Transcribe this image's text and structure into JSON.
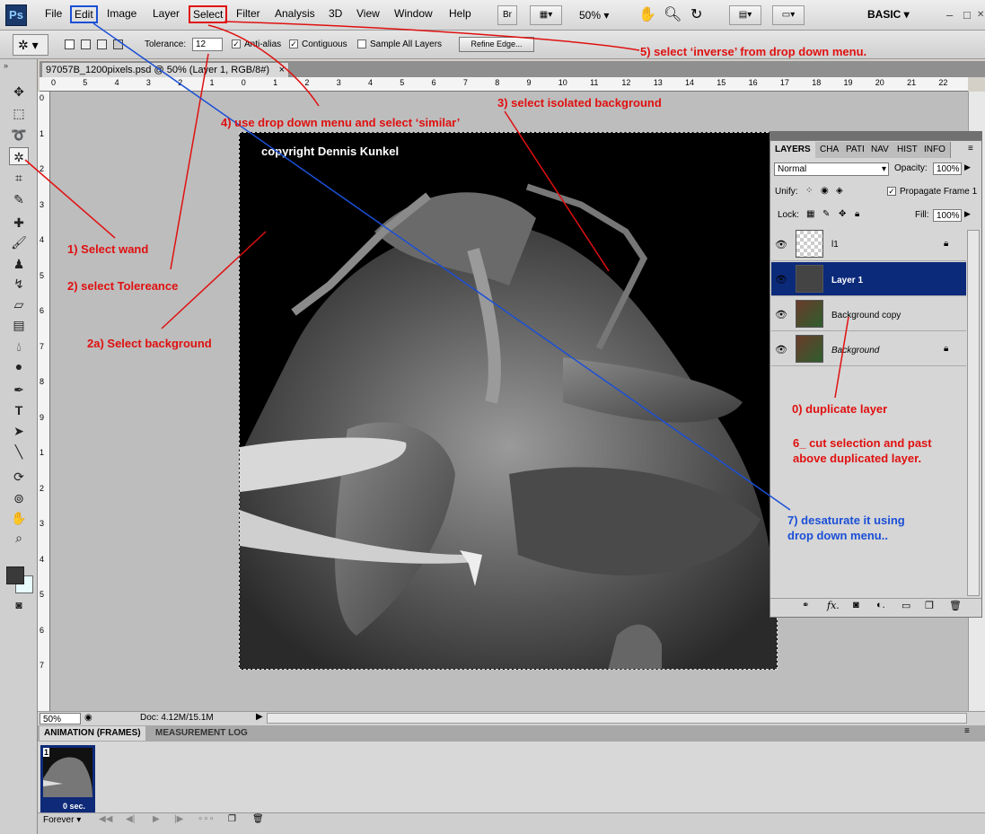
{
  "app": {
    "logo_text": "Ps",
    "workspace_label": "BASIC"
  },
  "menu": [
    "File",
    "Edit",
    "Image",
    "Layer",
    "Select",
    "Filter",
    "Analysis",
    "3D",
    "View",
    "Window",
    "Help"
  ],
  "toolbar": {
    "bridge_label": "Br",
    "zoom": "50%"
  },
  "window_controls": {
    "minimize": "–",
    "restore": "□",
    "close": "✕"
  },
  "options": {
    "tolerance_label": "Tolerance:",
    "tolerance_value": "12",
    "anti_alias": "Anti-alias",
    "contiguous": "Contiguous",
    "sample_all": "Sample All Layers",
    "refine_edge": "Refine Edge..."
  },
  "document": {
    "tab_title": "97057B_1200pixels.psd @ 50% (Layer 1, RGB/8#)",
    "close": "×",
    "watermark": "copyright Dennis Kunkel"
  },
  "ruler": {
    "h": [
      "0",
      "5",
      "4",
      "3",
      "2",
      "1",
      "0",
      "1",
      "2",
      "3",
      "4",
      "5",
      "6",
      "7",
      "8",
      "9",
      "10",
      "11",
      "12",
      "13",
      "14",
      "15",
      "16",
      "17",
      "18",
      "19",
      "20",
      "21",
      "22"
    ],
    "v": [
      "0",
      "1",
      "2",
      "3",
      "4",
      "5",
      "6",
      "7",
      "8",
      "9",
      "1",
      "2",
      "3",
      "4",
      "5",
      "6",
      "7"
    ]
  },
  "status": {
    "zoom": "50%",
    "doc": "Doc: 4.12M/15.1M"
  },
  "animation": {
    "tabs": [
      "ANIMATION (FRAMES)",
      "MEASUREMENT LOG"
    ],
    "frame_number": "1",
    "frame_delay": "0 sec.",
    "loop": "Forever"
  },
  "layers_panel": {
    "tabs": [
      "LAYERS",
      "CHA",
      "PATI",
      "NAV",
      "HIST",
      "INFO"
    ],
    "blend_mode": "Normal",
    "opacity_label": "Opacity:",
    "opacity": "100%",
    "unify_label": "Unify:",
    "propagate": "Propagate Frame 1",
    "lock_label": "Lock:",
    "fill_label": "Fill:",
    "fill": "100%",
    "layers": [
      {
        "name": "l1",
        "selected": false,
        "locked": true
      },
      {
        "name": "Layer 1",
        "selected": true,
        "locked": false
      },
      {
        "name": "Background copy",
        "selected": false,
        "locked": false
      },
      {
        "name": "Background",
        "selected": false,
        "locked": true
      }
    ]
  },
  "annotations": [
    {
      "text": "1) Select wand",
      "color": "#e01010"
    },
    {
      "text": "2) select Tolereance",
      "color": "#e01010"
    },
    {
      "text": "2a) Select background",
      "color": "#e01010"
    },
    {
      "text": "3) select isolated background",
      "color": "#e01010"
    },
    {
      "text": "4) use drop down menu and select ‘similar’",
      "color": "#e01010"
    },
    {
      "text": "5) select ‘inverse’ from drop down menu.",
      "color": "#e01010"
    },
    {
      "text": "0) duplicate layer",
      "color": "#e01010"
    },
    {
      "text": "6_ cut selection and past",
      "color": "#e01010"
    },
    {
      "text": "above duplicated layer.",
      "color": "#e01010"
    },
    {
      "text": "7) desaturate it using",
      "color": "#1a4fd6"
    },
    {
      "text": "drop down menu..",
      "color": "#1a4fd6"
    }
  ]
}
